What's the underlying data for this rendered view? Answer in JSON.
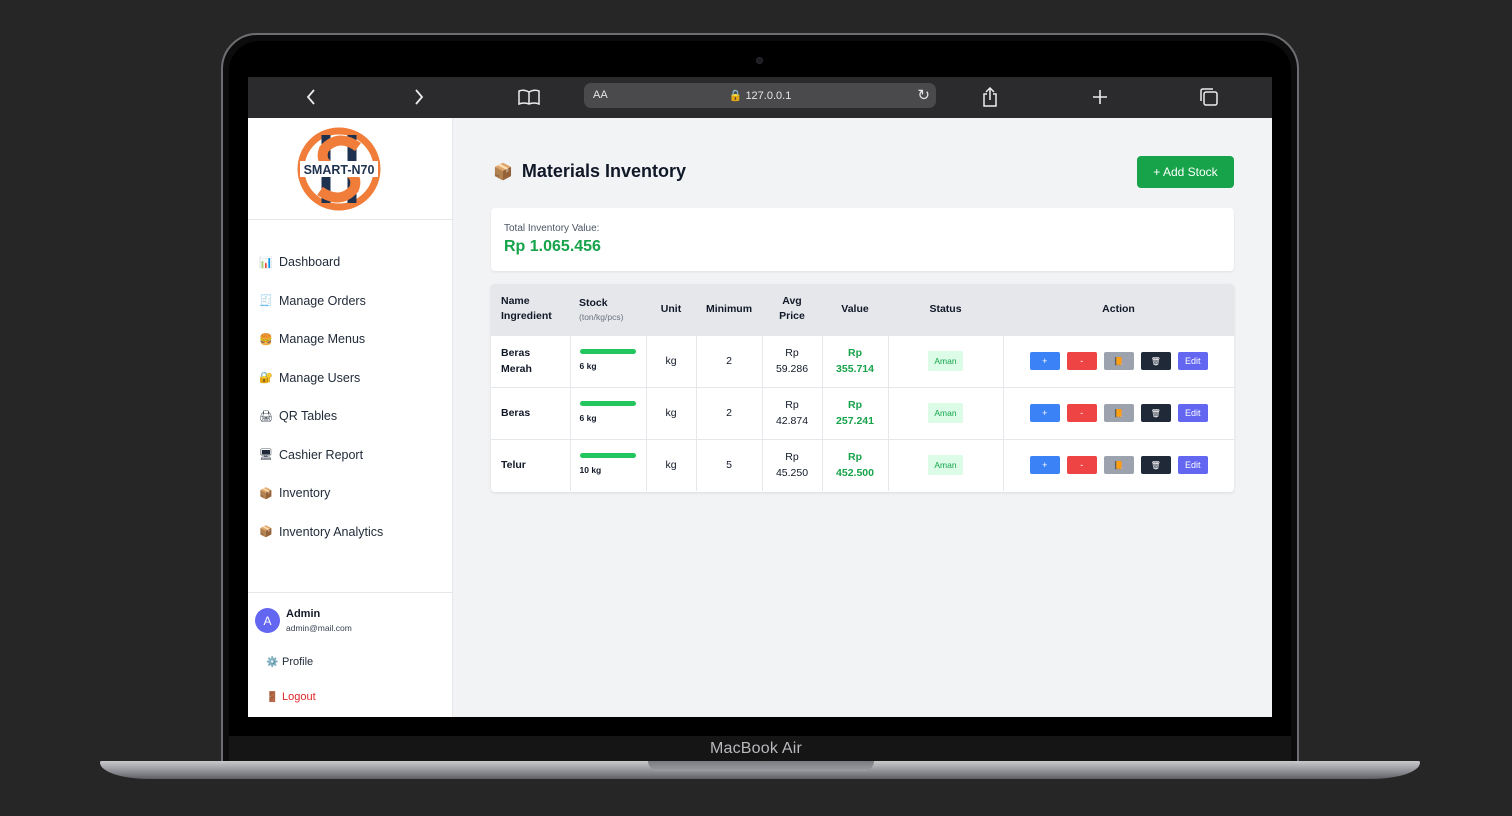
{
  "device": {
    "label": "MacBook Air"
  },
  "browser": {
    "address_prefix": "AA",
    "url": "127.0.0.1",
    "back_icon": "chevron-left-icon",
    "forward_icon": "chevron-right-icon"
  },
  "sidebar": {
    "logo_text": "SMART-N70",
    "items": [
      {
        "icon": "📊",
        "label": "Dashboard"
      },
      {
        "icon": "🧾",
        "label": "Manage Orders"
      },
      {
        "icon": "🍔",
        "label": "Manage Menus"
      },
      {
        "icon": "🔐",
        "label": "Manage Users"
      },
      {
        "icon": "🖨",
        "label": "QR Tables"
      },
      {
        "icon": "🖥",
        "label": "Cashier Report"
      },
      {
        "icon": "📦",
        "label": "Inventory"
      },
      {
        "icon": "📦",
        "label": "Inventory Analytics"
      }
    ],
    "user": {
      "initial": "A",
      "name": "Admin",
      "email": "admin@mail.com",
      "profile_label": "Profile",
      "logout_label": "Logout"
    }
  },
  "main": {
    "title_icon": "📦",
    "title": "Materials Inventory",
    "add_button": "+ Add Stock",
    "total_label": "Total Inventory Value:",
    "total_value": "Rp 1.065.456",
    "table": {
      "headers": {
        "name_line1": "Name",
        "name_line2": "Ingredient",
        "stock": "Stock",
        "stock_sub": "(ton/kg/pcs)",
        "unit": "Unit",
        "minimum": "Minimum",
        "avg_line1": "Avg",
        "avg_line2": "Price",
        "value": "Value",
        "status": "Status",
        "action": "Action"
      },
      "rows": [
        {
          "name1": "Beras",
          "name2": "Merah",
          "stock": "6 kg",
          "stock_level": 1.0,
          "unit": "kg",
          "minimum": "2",
          "avg1": "Rp",
          "avg2": "59.286",
          "val1": "Rp",
          "val2": "355.714",
          "status": "Aman"
        },
        {
          "name1": "Beras",
          "name2": "",
          "stock": "6 kg",
          "stock_level": 1.0,
          "unit": "kg",
          "minimum": "2",
          "avg1": "Rp",
          "avg2": "42.874",
          "val1": "Rp",
          "val2": "257.241",
          "status": "Aman"
        },
        {
          "name1": "Telur",
          "name2": "",
          "stock": "10 kg",
          "stock_level": 1.0,
          "unit": "kg",
          "minimum": "5",
          "avg1": "Rp",
          "avg2": "45.250",
          "val1": "Rp",
          "val2": "452.500",
          "status": "Aman"
        }
      ],
      "actions": {
        "plus": "+",
        "minus": "-",
        "edit": "Edit"
      }
    }
  },
  "colors": {
    "accent_green": "#16a34a",
    "button_blue": "#3b82f6",
    "button_red": "#ef4444",
    "edit_purple": "#6366f1",
    "logout_red": "#dc2626",
    "logo_orange": "#f07d3a",
    "logo_navy": "#1e3250"
  }
}
